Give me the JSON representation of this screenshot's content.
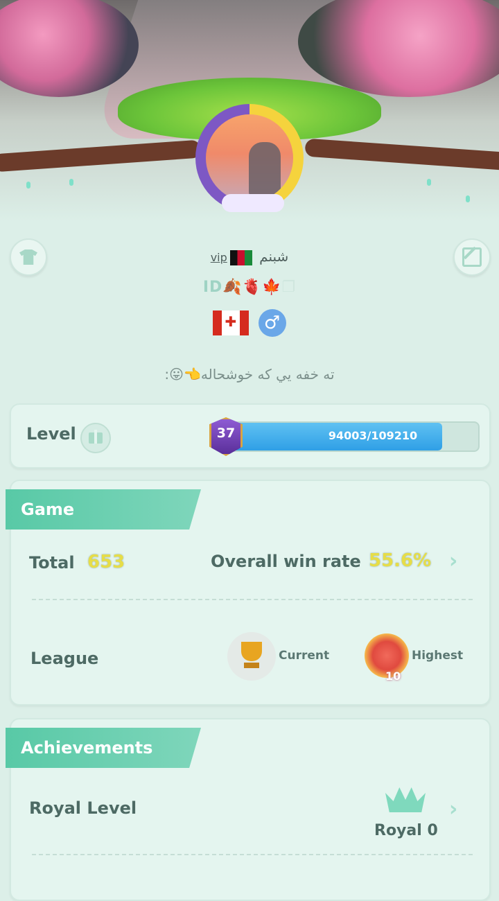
{
  "profile": {
    "name": "شبنم",
    "vip_label": "vip",
    "id_label": "ID",
    "id_emojis": "🍂🫀🍁",
    "gender_symbol": "♂",
    "bio": "ته خفه يي كه خوشحاله👈😛:"
  },
  "level": {
    "label": "Level",
    "badge_number": "37",
    "progress_text": "94003/109210",
    "progress_fraction": 0.861
  },
  "game": {
    "section_title": "Game",
    "total_label": "Total",
    "total_value": "653",
    "win_rate_label": "Overall win rate",
    "win_rate_value": "55.6%",
    "league_label": "League",
    "current_label": "Current",
    "highest_label": "Highest",
    "highest_badge_number": "10"
  },
  "achievements": {
    "section_title": "Achievements",
    "royal_label": "Royal Level",
    "royal_value": "Royal 0"
  },
  "colors": {
    "accent_green": "#58c9a6",
    "progress_blue": "#2f9fe6",
    "highlight_yellow": "#e6dd48"
  }
}
